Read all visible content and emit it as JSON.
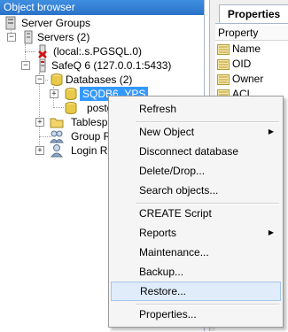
{
  "browser": {
    "title": "Object browser",
    "tree": {
      "root": "Server Groups",
      "servers": "Servers (2)",
      "local": "(local:.s.PGSQL.0)",
      "safeq": "SafeQ 6 (127.0.0.1:5433)",
      "databases": "Databases (2)",
      "selected_db": "SQDB6_YPS",
      "postgres": "postgres",
      "tablespaces": "Tablespaces",
      "group_roles": "Group Roles",
      "login_roles": "Login Roles"
    }
  },
  "properties": {
    "tab": "Properties",
    "header": "Property",
    "rows": [
      "Name",
      "OID",
      "Owner",
      "ACL"
    ]
  },
  "context_menu": {
    "refresh": "Refresh",
    "new_object": "New Object",
    "disconnect": "Disconnect database",
    "delete": "Delete/Drop...",
    "search": "Search objects...",
    "create_script": "CREATE Script",
    "reports": "Reports",
    "maintenance": "Maintenance...",
    "backup": "Backup...",
    "restore": "Restore...",
    "properties": "Properties...",
    "highlighted": "restore"
  },
  "colors": {
    "titlebar": "#2f7fd8",
    "selection": "#3399ff",
    "menu_highlight": "#e0ecfa"
  }
}
